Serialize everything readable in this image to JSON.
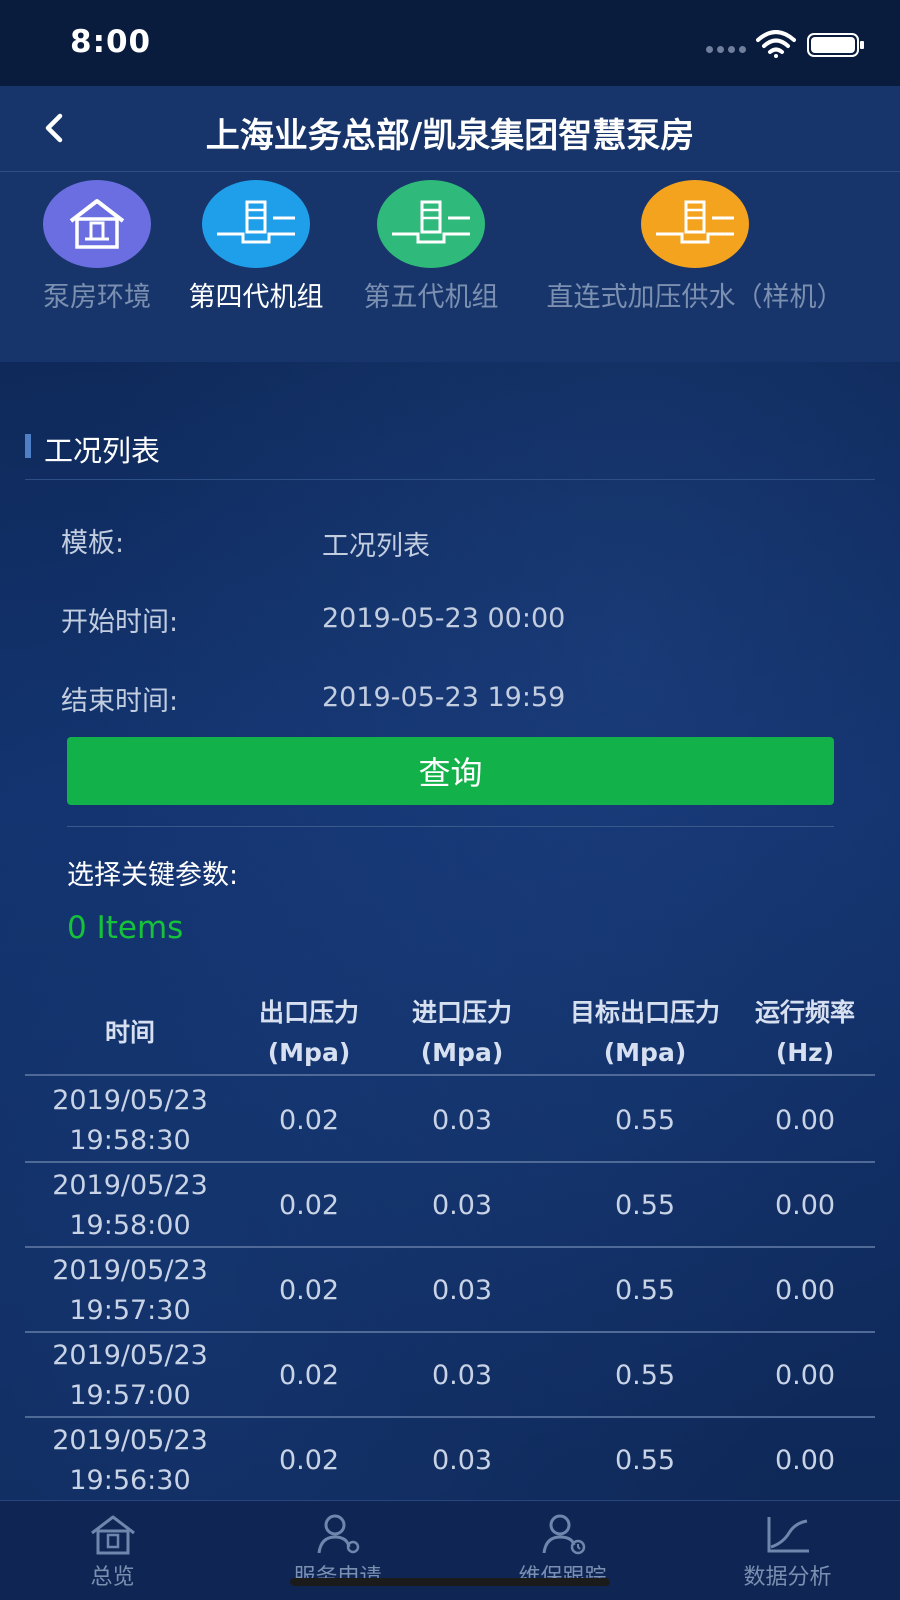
{
  "status_bar": {
    "time": "8:00"
  },
  "header": {
    "title": "上海业务总部/凯泉集团智慧泵房"
  },
  "tabs": [
    {
      "label": "泵房环境",
      "color": "#6a6ee0",
      "icon": "pump-house-icon"
    },
    {
      "label": "第四代机组",
      "color": "#1f9eea",
      "icon": "pump-unit-icon"
    },
    {
      "label": "第五代机组",
      "color": "#2fb97a",
      "icon": "pump-unit-icon"
    },
    {
      "label": "直连式加压供水（样机）",
      "color": "#f4a31e",
      "icon": "pump-unit-icon"
    }
  ],
  "section": {
    "title": "工况列表"
  },
  "form": {
    "template_label": "模板:",
    "template_value": "工况列表",
    "start_label": "开始时间:",
    "start_value": "2019-05-23 00:00",
    "end_label": "结束时间:",
    "end_value": "2019-05-23 19:59",
    "query_button": "查询"
  },
  "params": {
    "label": "选择关键参数:",
    "count": "0 Items"
  },
  "table": {
    "headers": [
      "时间",
      "出口压力(Mpa)",
      "进口压力(Mpa)",
      "目标出口压力(Mpa)",
      "运行频率(Hz)"
    ],
    "rows": [
      [
        "2019/05/23 19:58:30",
        "0.02",
        "0.03",
        "0.55",
        "0.00"
      ],
      [
        "2019/05/23 19:58:00",
        "0.02",
        "0.03",
        "0.55",
        "0.00"
      ],
      [
        "2019/05/23 19:57:30",
        "0.02",
        "0.03",
        "0.55",
        "0.00"
      ],
      [
        "2019/05/23 19:57:00",
        "0.02",
        "0.03",
        "0.55",
        "0.00"
      ],
      [
        "2019/05/23 19:56:30",
        "0.02",
        "0.03",
        "0.55",
        "0.00"
      ]
    ]
  },
  "bottom_nav": [
    {
      "label": "总览",
      "icon": "home-icon"
    },
    {
      "label": "服务申请",
      "icon": "service-request-icon"
    },
    {
      "label": "维保跟踪",
      "icon": "maintenance-tracking-icon"
    },
    {
      "label": "数据分析",
      "icon": "data-analysis-icon"
    }
  ]
}
